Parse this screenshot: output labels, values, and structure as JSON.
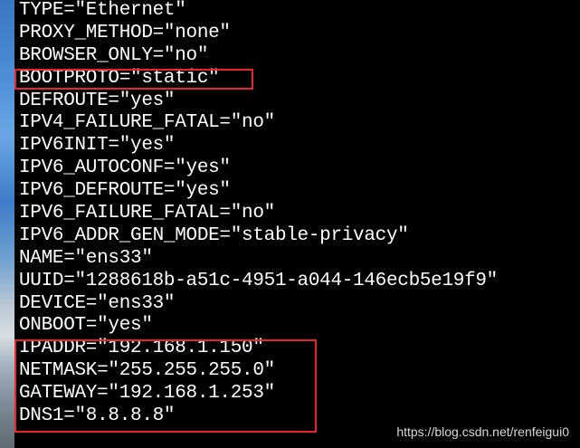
{
  "terminal": {
    "lines": [
      "TYPE=\"Ethernet\"",
      "PROXY_METHOD=\"none\"",
      "BROWSER_ONLY=\"no\"",
      "BOOTPROTO=\"static\"",
      "DEFROUTE=\"yes\"",
      "IPV4_FAILURE_FATAL=\"no\"",
      "IPV6INIT=\"yes\"",
      "IPV6_AUTOCONF=\"yes\"",
      "IPV6_DEFROUTE=\"yes\"",
      "IPV6_FAILURE_FATAL=\"no\"",
      "IPV6_ADDR_GEN_MODE=\"stable-privacy\"",
      "NAME=\"ens33\"",
      "UUID=\"1288618b-a51c-4951-a044-146ecb5e19f9\"",
      "DEVICE=\"ens33\"",
      "ONBOOT=\"yes\"",
      "IPADDR=\"192.168.1.150\"",
      "NETMASK=\"255.255.255.0\"",
      "GATEWAY=\"192.168.1.253\"",
      "DNS1=\"8.8.8.8\""
    ],
    "text_color": "#ffffff",
    "background_color": "#000000"
  },
  "highlights": {
    "color": "#e8262a"
  },
  "watermark": {
    "text": "https://blog.csdn.net/renfeigui0"
  }
}
